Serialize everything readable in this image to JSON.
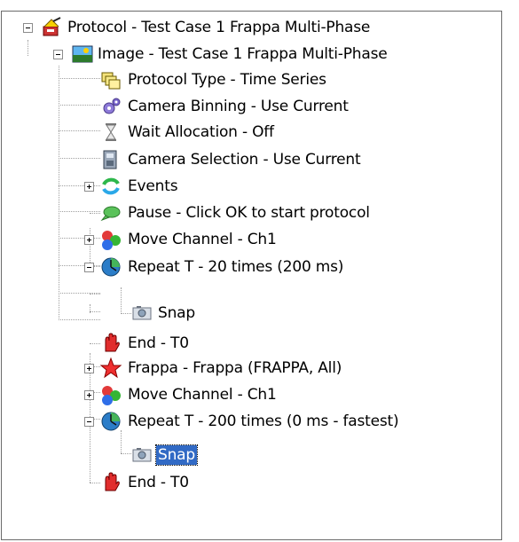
{
  "tree": {
    "nodes": [
      {
        "label": "Protocol - Test Case 1 Frappa Multi-Phase",
        "icon": "protocol-icon",
        "expander": "minus"
      },
      {
        "label": "Image - Test Case 1 Frappa Multi-Phase",
        "icon": "image-icon",
        "expander": "minus"
      },
      {
        "label": "Protocol Type - Time Series",
        "icon": "protocol-type-icon",
        "expander": "none"
      },
      {
        "label": "Camera Binning - Use Current",
        "icon": "camera-binning-icon",
        "expander": "none"
      },
      {
        "label": "Wait Allocation - Off",
        "icon": "hourglass-icon",
        "expander": "none"
      },
      {
        "label": "Camera Selection - Use Current",
        "icon": "camera-selection-icon",
        "expander": "none"
      },
      {
        "label": "Events",
        "icon": "events-icon",
        "expander": "plus"
      },
      {
        "label": "Pause - Click OK to start protocol",
        "icon": "pause-icon",
        "expander": "none"
      },
      {
        "label": "Move Channel - Ch1",
        "icon": "move-channel-icon",
        "expander": "plus"
      },
      {
        "label": "Repeat T - 20 times (200 ms)",
        "icon": "repeat-icon",
        "expander": "minus"
      },
      {
        "label": "Snap",
        "icon": "snap-camera-icon",
        "expander": "none"
      },
      {
        "label": "End - T0",
        "icon": "end-hand-icon",
        "expander": "none"
      },
      {
        "label": "Frappa - Frappa (FRAPPA, All)",
        "icon": "frappa-star-icon",
        "expander": "plus"
      },
      {
        "label": "Move Channel - Ch1",
        "icon": "move-channel-icon",
        "expander": "plus"
      },
      {
        "label": "Repeat T - 200 times (0 ms - fastest)",
        "icon": "repeat-icon",
        "expander": "minus"
      },
      {
        "label": "Snap",
        "icon": "snap-camera-icon",
        "expander": "none",
        "selected": true
      },
      {
        "label": "End - T0",
        "icon": "end-hand-icon",
        "expander": "none"
      }
    ]
  },
  "colors": {
    "selection": "#316ac5",
    "border": "#6b6b6b"
  }
}
